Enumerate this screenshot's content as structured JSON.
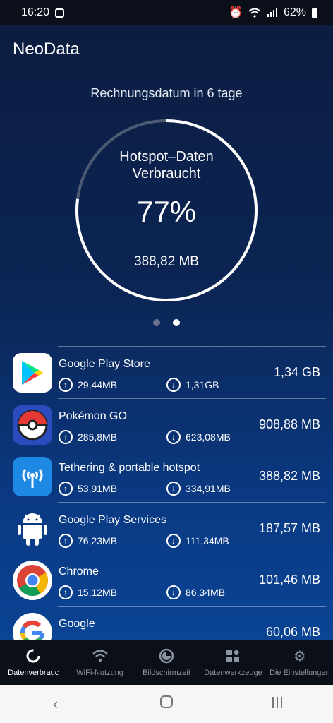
{
  "status": {
    "time": "16:20",
    "battery": "62%"
  },
  "app": {
    "title": "NeoData"
  },
  "billing": {
    "text": "Rechnungsdatum in 6 tage"
  },
  "gauge": {
    "label_line1": "Hotspot–Daten",
    "label_line2": "Verbraucht",
    "percent_text": "77%",
    "percent_value": 77,
    "amount": "388,82 MB"
  },
  "pager": {
    "pages": 2,
    "active": 2
  },
  "apps": [
    {
      "name": "Google Play Store",
      "up": "29,44MB",
      "down": "1,31GB",
      "total": "1,34 GB",
      "icon": "play-store-icon"
    },
    {
      "name": "Pokémon GO",
      "up": "285,8MB",
      "down": "623,08MB",
      "total": "908,88 MB",
      "icon": "pokemon-go-icon"
    },
    {
      "name": "Tethering & portable hotspot",
      "up": "53,91MB",
      "down": "334,91MB",
      "total": "388,82 MB",
      "icon": "hotspot-icon"
    },
    {
      "name": "Google Play Services",
      "up": "76,23MB",
      "down": "111,34MB",
      "total": "187,57 MB",
      "icon": "android-icon"
    },
    {
      "name": "Chrome",
      "up": "15,12MB",
      "down": "86,34MB",
      "total": "101,46 MB",
      "icon": "chrome-icon"
    },
    {
      "name": "Google",
      "up": "",
      "down": "",
      "total": "60,06 MB",
      "icon": "google-icon"
    }
  ],
  "nav": [
    {
      "label": "Datenverbrauc",
      "icon": "data-usage-icon"
    },
    {
      "label": "WiFi-Nutzung",
      "icon": "wifi-icon"
    },
    {
      "label": "Bildschirmzeit",
      "icon": "screen-time-icon"
    },
    {
      "label": "Datenwerkzeuge",
      "icon": "tools-icon"
    },
    {
      "label": "Die Einstellungen",
      "icon": "settings-icon"
    }
  ],
  "colors": {
    "accent": "#ffffff",
    "background_top": "#0c1c3f",
    "background_bottom": "#0a4a9e",
    "nav_bg": "#0b0f18"
  }
}
